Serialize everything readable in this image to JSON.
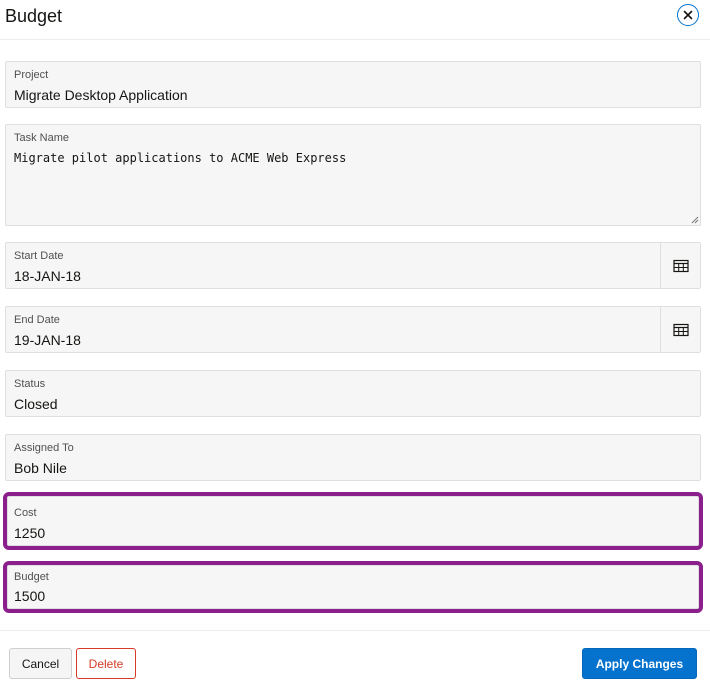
{
  "dialog": {
    "title": "Budget",
    "close_icon": "close-icon"
  },
  "fields": {
    "project": {
      "label": "Project",
      "value": "Migrate Desktop Application"
    },
    "task_name": {
      "label": "Task Name",
      "value": "Migrate pilot applications to ACME Web Express"
    },
    "start_date": {
      "label": "Start Date",
      "value": "18-JAN-18",
      "icon": "calendar-icon"
    },
    "end_date": {
      "label": "End Date",
      "value": "19-JAN-18",
      "icon": "calendar-icon"
    },
    "status": {
      "label": "Status",
      "value": "Closed"
    },
    "assigned_to": {
      "label": "Assigned To",
      "value": "Bob Nile"
    },
    "cost": {
      "label": "Cost",
      "value": "1250"
    },
    "budget": {
      "label": "Budget",
      "value": "1500"
    }
  },
  "buttons": {
    "cancel": "Cancel",
    "delete": "Delete",
    "apply": "Apply Changes"
  },
  "colors": {
    "accent": "#0572ce",
    "danger": "#d63b25",
    "highlight": "#8b1f8b"
  }
}
